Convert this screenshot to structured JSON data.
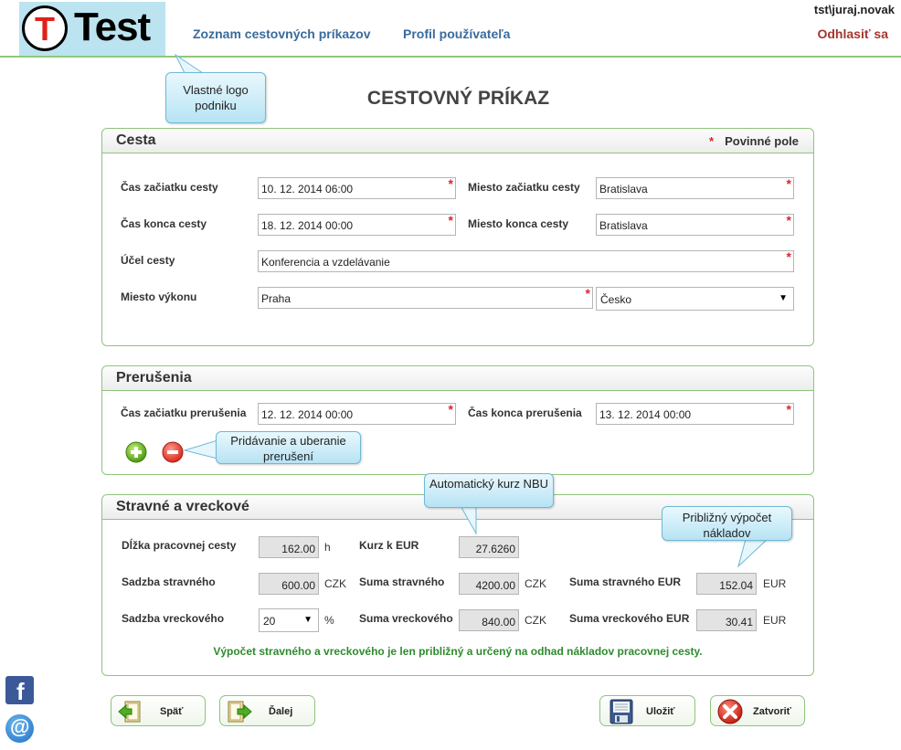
{
  "header": {
    "logo_letter": "T",
    "logo_word": "Test",
    "nav": [
      "Zoznam cestovných príkazov",
      "Profil používateľa"
    ],
    "user": "tst\\juraj.novak",
    "logout": "Odhlasiť sa"
  },
  "callouts": {
    "logo": "Vlastné logo podniku",
    "interrupt": "Pridávanie a uberanie prerušení",
    "rate": "Automatický kurz NBU",
    "estimate": "Približný výpočet nákladov"
  },
  "page_title": "CESTOVNÝ PRÍKAZ",
  "trip": {
    "title": "Cesta",
    "required_star": "*",
    "required_label": "Povinné pole",
    "start_time_label": "Čas začiatku cesty",
    "start_time": "10. 12. 2014 06:00",
    "start_place_label": "Miesto začiatku cesty",
    "start_place": "Bratislava",
    "end_time_label": "Čas konca cesty",
    "end_time": "18. 12. 2014 00:00",
    "end_place_label": "Miesto konca cesty",
    "end_place": "Bratislava",
    "purpose_label": "Účel cesty",
    "purpose": "Konferencia a vzdelávanie",
    "venue_label": "Miesto výkonu",
    "venue": "Praha",
    "country": "Česko"
  },
  "interruptions": {
    "title": "Prerušenia",
    "start_label": "Čas začiatku prerušenia",
    "start": "12. 12. 2014 00:00",
    "end_label": "Čas konca prerušenia",
    "end": "13. 12. 2014 00:00"
  },
  "allowance": {
    "title": "Stravné a vreckové",
    "duration_label": "Dĺžka pracovnej cesty",
    "duration": "162.00",
    "duration_unit": "h",
    "rate_label": "Kurz k EUR",
    "rate": "27.6260",
    "meal_rate_label": "Sadzba stravného",
    "meal_rate": "600.00",
    "meal_rate_unit": "CZK",
    "meal_sum_label": "Suma stravného",
    "meal_sum": "4200.00",
    "meal_sum_unit": "CZK",
    "meal_eur_label": "Suma stravného EUR",
    "meal_eur": "152.04",
    "meal_eur_unit": "EUR",
    "pocket_rate_label": "Sadzba vreckového",
    "pocket_rate": "20",
    "pocket_rate_unit": "%",
    "pocket_sum_label": "Suma vreckového",
    "pocket_sum": "840.00",
    "pocket_sum_unit": "CZK",
    "pocket_eur_label": "Suma vreckového EUR",
    "pocket_eur": "30.41",
    "pocket_eur_unit": "EUR",
    "note": "Výpočet stravného a vreckového je len približný a určený na odhad nákladov pracovnej cesty."
  },
  "buttons": {
    "back": "Späť",
    "next": "Ďalej",
    "save": "Uložiť",
    "close": "Zatvoriť"
  },
  "social": {
    "facebook_glyph": "f",
    "email_glyph": "@"
  },
  "colors": {
    "accent_green": "#8ec47e",
    "nav_blue": "#3a6b9b",
    "logout_red": "#a5352e",
    "required_red": "#d9262d",
    "note_green": "#2f8a2f"
  }
}
